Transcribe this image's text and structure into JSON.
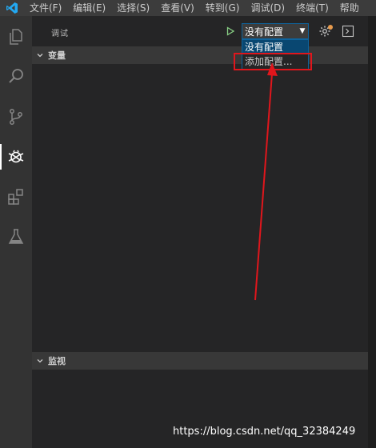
{
  "menubar": {
    "items": [
      "文件(F)",
      "编辑(E)",
      "选择(S)",
      "查看(V)",
      "转到(G)",
      "调试(D)",
      "终端(T)",
      "帮助"
    ]
  },
  "activitybar": {
    "icons": [
      "files-icon",
      "search-icon",
      "source-control-icon",
      "debug-icon",
      "extensions-icon",
      "test-flask-icon"
    ],
    "active": "debug-icon"
  },
  "debug": {
    "title": "调试",
    "config_selected": "没有配置",
    "options": [
      "没有配置",
      "添加配置..."
    ]
  },
  "sections": {
    "variables": "变量",
    "watch": "监视"
  },
  "watermark": "https://blog.csdn.net/qq_32384249",
  "colors": {
    "accent": "#0e639c",
    "annotation": "#e0161c",
    "run": "#89d185"
  }
}
